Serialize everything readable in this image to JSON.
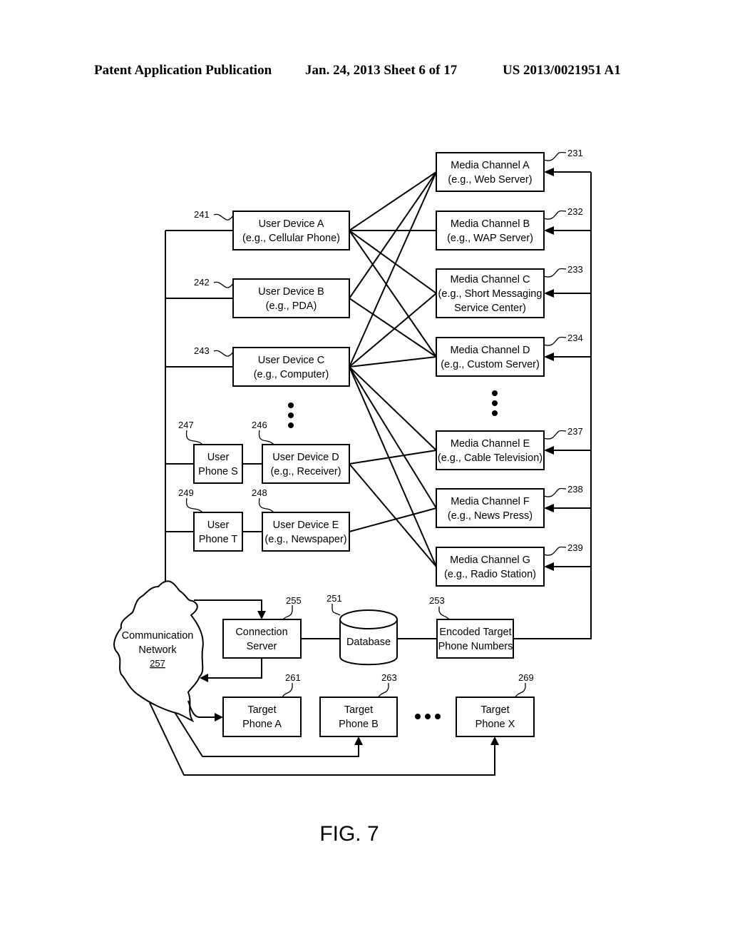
{
  "header": {
    "publication": "Patent Application Publication",
    "date_sheet": "Jan. 24, 2013   Sheet 6 of 17",
    "pub_number": "US 2013/0021951 A1"
  },
  "figure_label": "FIG. 7",
  "media_channels": [
    {
      "ref": "231",
      "line1": "Media Channel  A",
      "line2": "(e.g., Web Server)",
      "line3": ""
    },
    {
      "ref": "232",
      "line1": "Media Channel  B",
      "line2": "(e.g., WAP Server)",
      "line3": ""
    },
    {
      "ref": "233",
      "line1": "Media Channel  C",
      "line2": "(e.g., Short Messaging",
      "line3": "Service Center)"
    },
    {
      "ref": "234",
      "line1": "Media Channel  D",
      "line2": "(e.g., Custom Server)",
      "line3": ""
    },
    {
      "ref": "237",
      "line1": "Media Channel  E",
      "line2": "(e.g., Cable Television)",
      "line3": ""
    },
    {
      "ref": "238",
      "line1": "Media Channel  F",
      "line2": "(e.g., News Press)",
      "line3": ""
    },
    {
      "ref": "239",
      "line1": "Media Channel  G",
      "line2": "(e.g., Radio Station)",
      "line3": ""
    }
  ],
  "user_devices": [
    {
      "ref": "241",
      "line1": "User Device  A",
      "line2": "(e.g., Cellular Phone)"
    },
    {
      "ref": "242",
      "line1": "User Device  B",
      "line2": "(e.g., PDA)"
    },
    {
      "ref": "243",
      "line1": "User Device  C",
      "line2": "(e.g., Computer)"
    },
    {
      "ref": "246",
      "line1": "User Device  D",
      "line2": "(e.g., Receiver)"
    },
    {
      "ref": "248",
      "line1": "User Device  E",
      "line2": "(e.g., Newspaper)"
    }
  ],
  "user_phones": [
    {
      "ref": "247",
      "line1": "User",
      "line2": "Phone S"
    },
    {
      "ref": "249",
      "line1": "User",
      "line2": "Phone T"
    }
  ],
  "device_channel_links": [
    {
      "device": 0,
      "channels": [
        0,
        1,
        2,
        3
      ]
    },
    {
      "device": 1,
      "channels": [
        0,
        3
      ]
    },
    {
      "device": 2,
      "channels": [
        0,
        2,
        3,
        4,
        5,
        6
      ]
    },
    {
      "device": 3,
      "channels": [
        4,
        6
      ]
    },
    {
      "device": 4,
      "channels": [
        5
      ]
    }
  ],
  "network": {
    "line1": "Communication",
    "line2": "Network",
    "ref": "257"
  },
  "connection_server": {
    "ref": "255",
    "line1": "Connection",
    "line2": "Server"
  },
  "database": {
    "ref": "251",
    "label": "Database"
  },
  "encoded_numbers": {
    "ref": "253",
    "line1": "Encoded Target",
    "line2": "Phone Numbers"
  },
  "target_phones": [
    {
      "ref": "261",
      "line1": "Target",
      "line2": "Phone A"
    },
    {
      "ref": "263",
      "line1": "Target",
      "line2": "Phone B"
    },
    {
      "ref": "269",
      "line1": "Target",
      "line2": "Phone X"
    }
  ]
}
